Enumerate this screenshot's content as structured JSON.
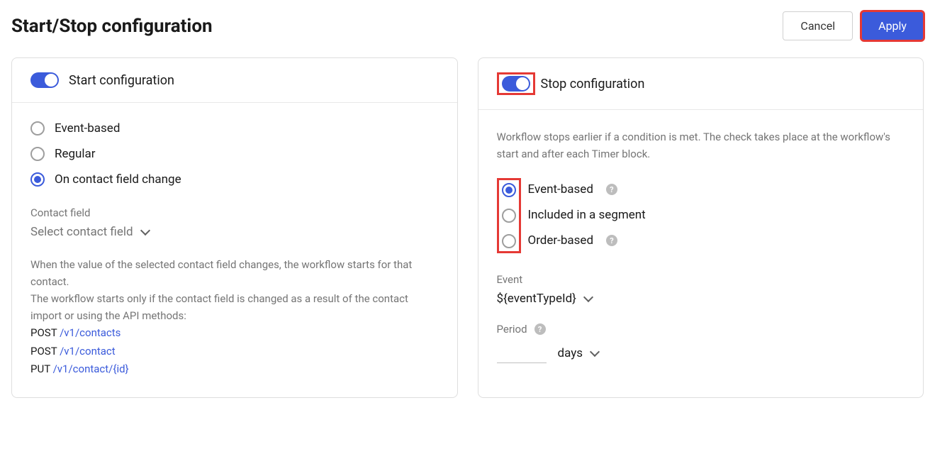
{
  "page_title": "Start/Stop configuration",
  "buttons": {
    "cancel": "Cancel",
    "apply": "Apply"
  },
  "start": {
    "title": "Start configuration",
    "options": {
      "event_based": "Event-based",
      "regular": "Regular",
      "on_change": "On contact field change"
    },
    "contact_field_label": "Contact field",
    "contact_field_value": "Select contact field",
    "help_line1": "When the value of the selected contact field changes, the workflow starts for that contact.",
    "help_line2": "The workflow starts only if the contact field is changed as a result of the contact import or using the API methods:",
    "api": {
      "m1": "POST",
      "p1": "/v1/contacts",
      "m2": "POST",
      "p2": "/v1/contact",
      "m3": "PUT",
      "p3": "/v1/contact/{id}"
    }
  },
  "stop": {
    "title": "Stop configuration",
    "description": "Workflow stops earlier if a condition is met. The check takes place at the workflow's start and after each Timer block.",
    "options": {
      "event_based": "Event-based",
      "in_segment": "Included in a segment",
      "order_based": "Order-based"
    },
    "event_label": "Event",
    "event_value": "${eventTypeId}",
    "period_label": "Period",
    "period_unit": "days"
  }
}
